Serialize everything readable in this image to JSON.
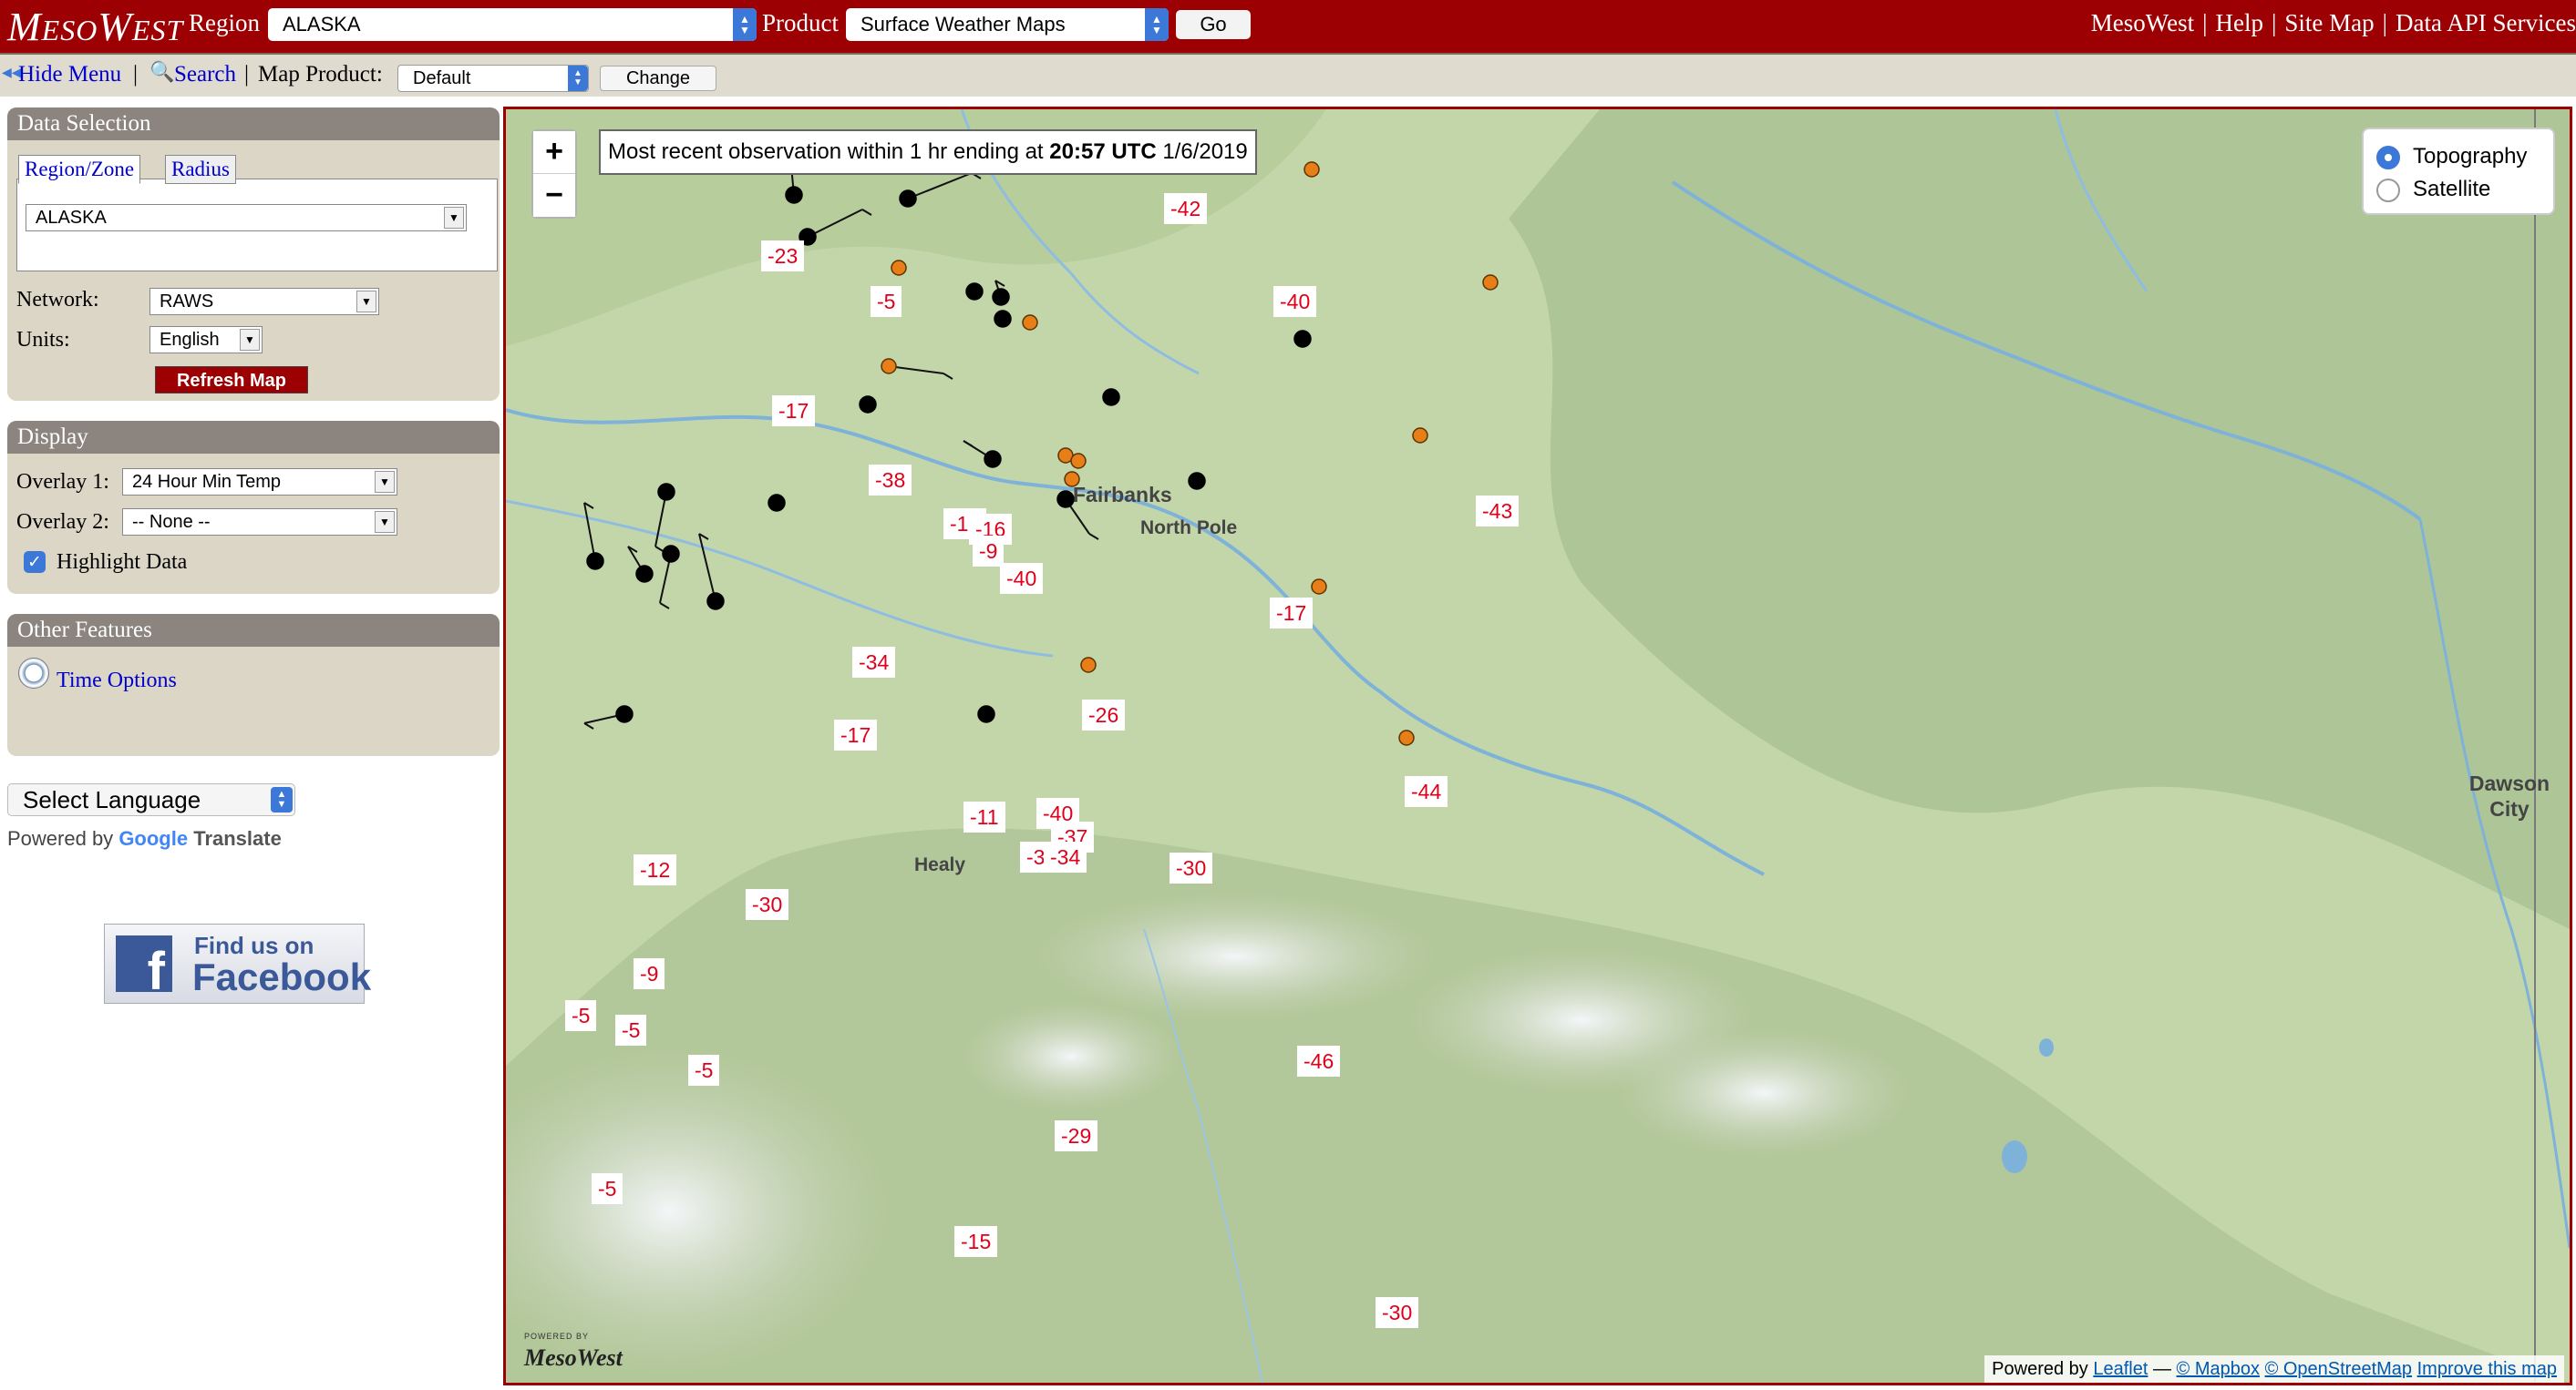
{
  "header": {
    "logo": "MesoWest",
    "region_label": "Region",
    "region_value": "ALASKA",
    "product_label": "Product",
    "product_value": "Surface Weather Maps",
    "go_label": "Go",
    "links": [
      "MesoWest",
      "Help",
      "Site Map",
      "Data API Services"
    ],
    "link_separator": "|"
  },
  "subbar": {
    "hide_menu": "Hide Menu",
    "search": "Search",
    "map_product_label": "Map Product:",
    "map_product_value": "Default",
    "change_label": "Change",
    "separator": "|"
  },
  "data_selection": {
    "title": "Data Selection",
    "tabs": [
      "Region/Zone",
      "Radius"
    ],
    "region_value": "ALASKA",
    "network_label": "Network:",
    "network_value": "RAWS",
    "units_label": "Units:",
    "units_value": "English",
    "refresh_label": "Refresh Map"
  },
  "display": {
    "title": "Display",
    "overlay1_label": "Overlay 1:",
    "overlay1_value": "24 Hour Min Temp",
    "overlay2_label": "Overlay 2:",
    "overlay2_value": "-- None --",
    "highlight_label": "Highlight Data",
    "highlight_checked": true
  },
  "other_features": {
    "title": "Other Features",
    "time_options": "Time Options"
  },
  "translate": {
    "select_language": "Select Language",
    "powered_by": "Powered by",
    "google": "Google",
    "translate": "Translate"
  },
  "facebook": {
    "line1": "Find us on",
    "line2": "Facebook"
  },
  "map": {
    "zoom_in": "+",
    "zoom_out": "−",
    "banner_prefix": "Most recent observation within 1 hr ending at",
    "banner_time": "20:57 UTC",
    "banner_date": "1/6/2019",
    "layers": [
      "Topography",
      "Satellite"
    ],
    "selected_layer": "Topography",
    "places": [
      "Fairbanks",
      "North Pole",
      "Healy",
      "Dawson City"
    ],
    "attribution": {
      "powered_by": "Powered by",
      "leaflet": "Leaflet",
      "dash": "—",
      "mapbox": "© Mapbox",
      "osm": "© OpenStreetMap",
      "improve": "Improve this map"
    },
    "watermark": "MesoWest",
    "watermark_top": "POWERED BY",
    "temperature_labels": [
      "-42",
      "-23",
      "-5",
      "-40",
      "-17",
      "-38",
      "-10",
      "-16",
      "-9",
      "-40",
      "-43",
      "-17",
      "-34",
      "-17",
      "-26",
      "-11",
      "-40",
      "-37",
      "-3",
      "-34",
      "-30",
      "-44",
      "-12",
      "-30",
      "-9",
      "-5",
      "-5",
      "-5",
      "-46",
      "-29",
      "-5",
      "-15",
      "-30"
    ],
    "colors": {
      "cold_marker": "#e87e17",
      "station_marker": "#000000",
      "label_text": "#e0001b",
      "frame": "#9c0002"
    }
  }
}
